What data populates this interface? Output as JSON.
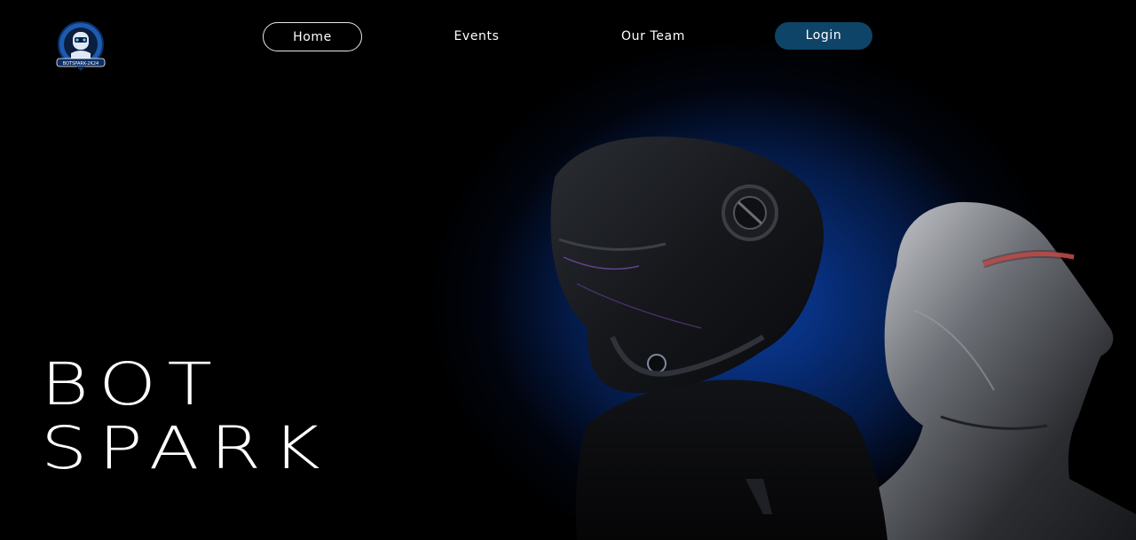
{
  "navbar": {
    "logo_icon": "botspark-robot-logo-icon",
    "logo_text": "BOTSPARK-2K24",
    "links": [
      {
        "label": "Home",
        "active": true
      },
      {
        "label": "Events",
        "active": false
      },
      {
        "label": "Our Team",
        "active": false
      }
    ],
    "login_label": "Login"
  },
  "hero": {
    "title_line1": "BOT",
    "title_line2": "SPARK",
    "artwork_icon": "helmet-robots-illustration-icon"
  },
  "colors": {
    "background": "#000000",
    "accent_blue": "#0a3fa0",
    "login_button": "#0e4467",
    "text": "#ffffff"
  }
}
